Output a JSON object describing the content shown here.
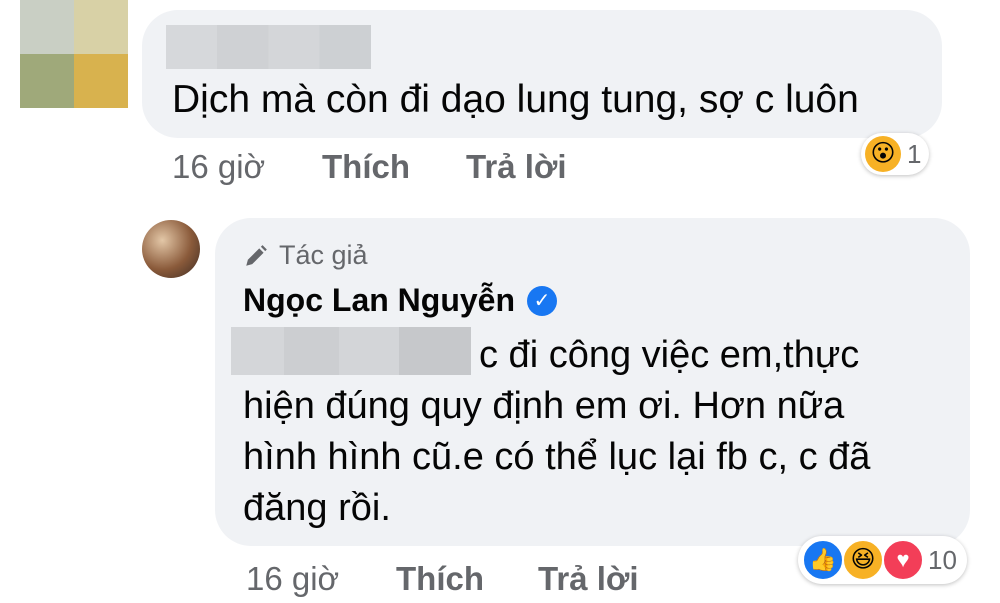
{
  "comment": {
    "text": "Dịch mà còn đi dạo lung tung, sợ c luôn",
    "time": "16 giờ",
    "like_label": "Thích",
    "reply_label": "Trả lời",
    "reaction_count": "1",
    "reaction_icons": [
      "wow"
    ]
  },
  "reply": {
    "badge": "Tác giả",
    "author": "Ngọc Lan Nguyễn",
    "verified": true,
    "text_line1": "c đi công việc em,thực",
    "text_line2": "hiện đúng quy định em ơi. Hơn nữa",
    "text_line3": "hình hình cũ.e có thể lục lại fb c, c đã",
    "text_line4": "đăng rồi.",
    "time": "16 giờ",
    "like_label": "Thích",
    "reply_label": "Trả lời",
    "reaction_count": "10",
    "reaction_icons": [
      "like",
      "haha",
      "love"
    ]
  },
  "colors": {
    "bubble": "#f0f2f5",
    "meta_text": "#65676b",
    "verified_blue": "#1877f2"
  }
}
